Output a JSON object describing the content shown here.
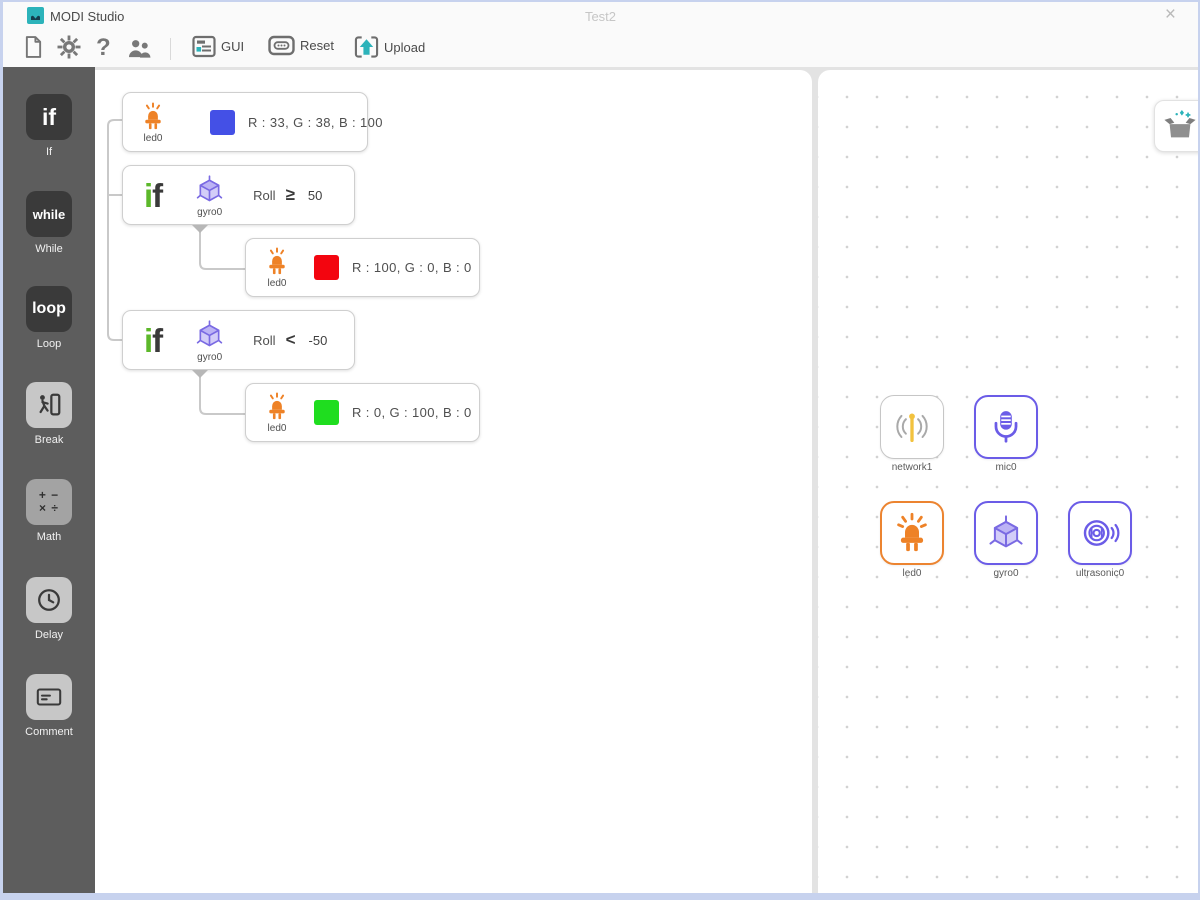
{
  "window": {
    "app_title": "MODI Studio",
    "document_title": "Test2",
    "close": "×"
  },
  "toolbar": {
    "gui": "GUI",
    "reset": "Reset",
    "upload": "Upload"
  },
  "sidebar": {
    "items": [
      {
        "key": "if",
        "glyph": "if",
        "label": "If"
      },
      {
        "key": "while",
        "glyph": "while",
        "label": "While"
      },
      {
        "key": "loop",
        "glyph": "loop",
        "label": "Loop"
      },
      {
        "key": "break",
        "label": "Break"
      },
      {
        "key": "math",
        "glyph_top": "+ −",
        "glyph_bottom": "× ÷",
        "label": "Math"
      },
      {
        "key": "delay",
        "label": "Delay"
      },
      {
        "key": "comment",
        "label": "Comment"
      }
    ]
  },
  "canvas": {
    "blocks": [
      {
        "kind": "led",
        "module": "led0",
        "swatch": "#4450e6",
        "text": "R : 33, G : 38, B : 100"
      },
      {
        "kind": "if",
        "keyword": "if",
        "module": "gyro0",
        "property": "Roll",
        "operator": "≥",
        "value": "50"
      },
      {
        "kind": "led",
        "module": "led0",
        "swatch": "#f3050f",
        "text": "R : 100, G : 0, B : 0"
      },
      {
        "kind": "if",
        "keyword": "if",
        "module": "gyro0",
        "property": "Roll",
        "operator": "<",
        "value": "-50"
      },
      {
        "kind": "led",
        "module": "led0",
        "swatch": "#1fdd1f",
        "text": "R : 0, G : 100, B : 0"
      }
    ]
  },
  "modules_panel": {
    "modules": [
      {
        "name": "network1",
        "accent": "#c6c6c6"
      },
      {
        "name": "mic0",
        "accent": "#6b5ce7"
      },
      {
        "name": "led0",
        "accent": "#ec8430"
      },
      {
        "name": "gyro0",
        "accent": "#6b5ce7"
      },
      {
        "name": "ultrasonic0",
        "accent": "#6b5ce7"
      }
    ]
  },
  "icons": {
    "new-file-icon": "blank page with folded corner",
    "settings-icon": "gear",
    "help-icon": "question mark",
    "community-icon": "two people silhouettes",
    "gui-icon": "window panel with teal block",
    "reset-icon": "module chip outline",
    "upload-icon": "teal up arrow in brackets",
    "add-module-icon": "open box with teal sparkles",
    "led-icon": "orange LED lamp with rays",
    "gyro-icon": "purple 3D cube with axes",
    "mic-icon": "purple microphone",
    "network-icon": "yellow antenna with signal waves",
    "ultrasonic-icon": "purple concentric sensor with waves"
  },
  "colors": {
    "teal": "#2cb3ba",
    "purple": "#6b5ce7",
    "orange": "#ee8227",
    "if_green": "#5cb82a"
  }
}
